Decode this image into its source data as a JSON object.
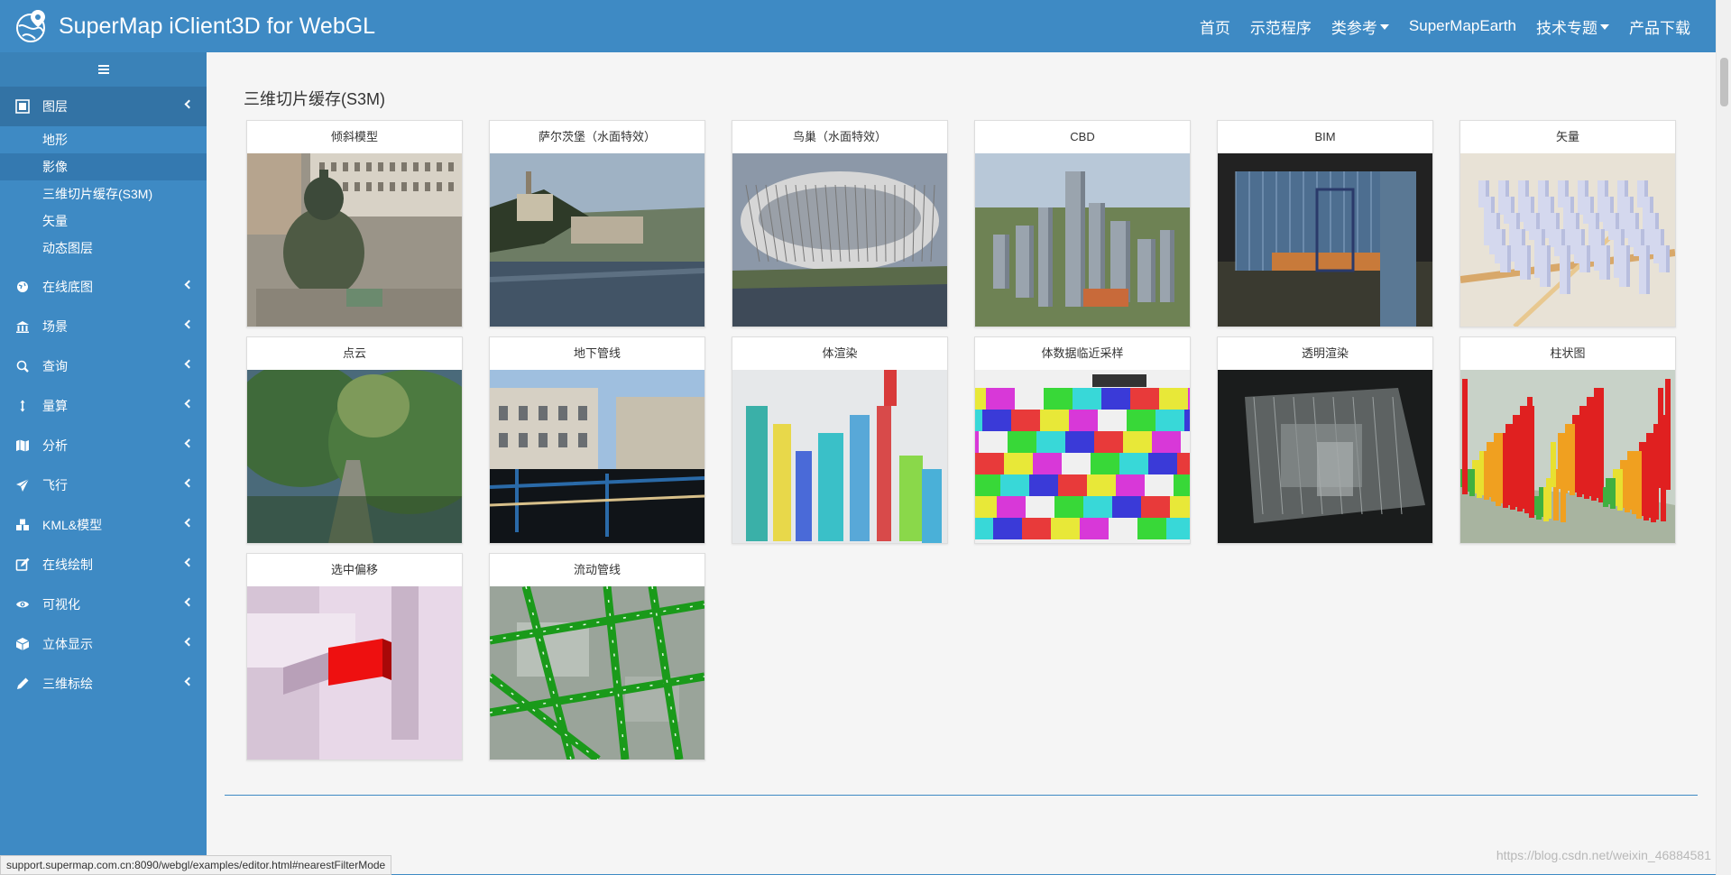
{
  "header": {
    "brand": "SuperMap iClient3D for WebGL",
    "nav": [
      {
        "label": "首页",
        "dropdown": false
      },
      {
        "label": "示范程序",
        "dropdown": false
      },
      {
        "label": "类参考",
        "dropdown": true
      },
      {
        "label": "SuperMapEarth",
        "dropdown": false
      },
      {
        "label": "技术专题",
        "dropdown": true
      },
      {
        "label": "产品下载",
        "dropdown": false
      }
    ]
  },
  "sidebar": {
    "menus": [
      {
        "label": "图层",
        "icon": "layers-icon",
        "expanded": true,
        "items": [
          {
            "label": "地形",
            "selected": false
          },
          {
            "label": "影像",
            "selected": true
          },
          {
            "label": "三维切片缓存(S3M)",
            "selected": false
          },
          {
            "label": "矢量",
            "selected": false
          },
          {
            "label": "动态图层",
            "selected": false
          }
        ]
      },
      {
        "label": "在线底图",
        "icon": "globe-icon",
        "expanded": false
      },
      {
        "label": "场景",
        "icon": "bank-icon",
        "expanded": false
      },
      {
        "label": "查询",
        "icon": "search-icon",
        "expanded": false
      },
      {
        "label": "量算",
        "icon": "measure-icon",
        "expanded": false
      },
      {
        "label": "分析",
        "icon": "map-icon",
        "expanded": false
      },
      {
        "label": "飞行",
        "icon": "plane-icon",
        "expanded": false
      },
      {
        "label": "KML&模型",
        "icon": "cubes-icon",
        "expanded": false
      },
      {
        "label": "在线绘制",
        "icon": "edit-icon",
        "expanded": false
      },
      {
        "label": "可视化",
        "icon": "eye-icon",
        "expanded": false
      },
      {
        "label": "立体显示",
        "icon": "cube-icon",
        "expanded": false
      },
      {
        "label": "三维标绘",
        "icon": "pencil-icon",
        "expanded": false
      }
    ]
  },
  "main": {
    "section_title": "三维切片缓存(S3M)",
    "cards": [
      {
        "title": "倾斜模型",
        "thumb": "oblique"
      },
      {
        "title": "萨尔茨堡（水面特效）",
        "thumb": "salzburg"
      },
      {
        "title": "鸟巢（水面特效）",
        "thumb": "birdnest"
      },
      {
        "title": "CBD",
        "thumb": "cbd"
      },
      {
        "title": "BIM",
        "thumb": "bim"
      },
      {
        "title": "矢量",
        "thumb": "vector"
      },
      {
        "title": "点云",
        "thumb": "pointcloud"
      },
      {
        "title": "地下管线",
        "thumb": "pipeline"
      },
      {
        "title": "体渲染",
        "thumb": "volume"
      },
      {
        "title": "体数据临近采样",
        "thumb": "nearest"
      },
      {
        "title": "透明渲染",
        "thumb": "transparent"
      },
      {
        "title": "柱状图",
        "thumb": "histogram"
      },
      {
        "title": "选中偏移",
        "thumb": "offset"
      },
      {
        "title": "流动管线",
        "thumb": "flowpipe"
      }
    ]
  },
  "status": {
    "url": "support.supermap.com.cn:8090/webgl/examples/editor.html#nearestFilterMode",
    "watermark": "https://blog.csdn.net/weixin_46884581"
  }
}
